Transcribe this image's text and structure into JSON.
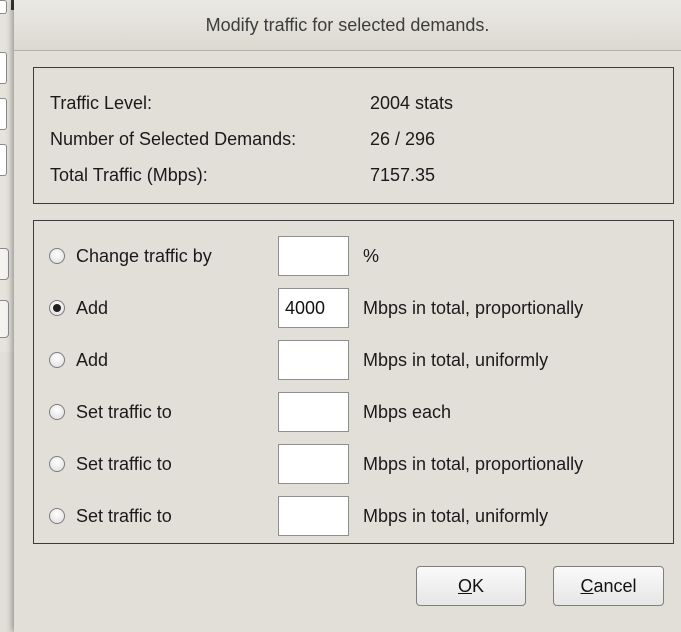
{
  "dialog": {
    "title": "Modify traffic for selected demands."
  },
  "info": {
    "items": [
      {
        "label": "Traffic Level:",
        "value": "2004 stats"
      },
      {
        "label": "Number of Selected Demands:",
        "value": "26 / 296"
      },
      {
        "label": "Total Traffic (Mbps):",
        "value": "7157.35"
      }
    ]
  },
  "options": [
    {
      "label": "Change traffic by",
      "value": "",
      "unit": "%",
      "checked": false
    },
    {
      "label": "Add",
      "value": "4000",
      "unit": "Mbps in total, proportionally",
      "checked": true
    },
    {
      "label": "Add",
      "value": "",
      "unit": "Mbps in total, uniformly",
      "checked": false
    },
    {
      "label": "Set traffic to",
      "value": "",
      "unit": "Mbps each",
      "checked": false
    },
    {
      "label": "Set traffic to",
      "value": "",
      "unit": "Mbps in total, proportionally",
      "checked": false
    },
    {
      "label": "Set traffic to",
      "value": "",
      "unit": "Mbps in total, uniformly",
      "checked": false
    }
  ],
  "buttons": {
    "ok_mnemonic": "O",
    "ok_rest": "K",
    "cancel_mnemonic": "C",
    "cancel_rest": "ancel"
  }
}
